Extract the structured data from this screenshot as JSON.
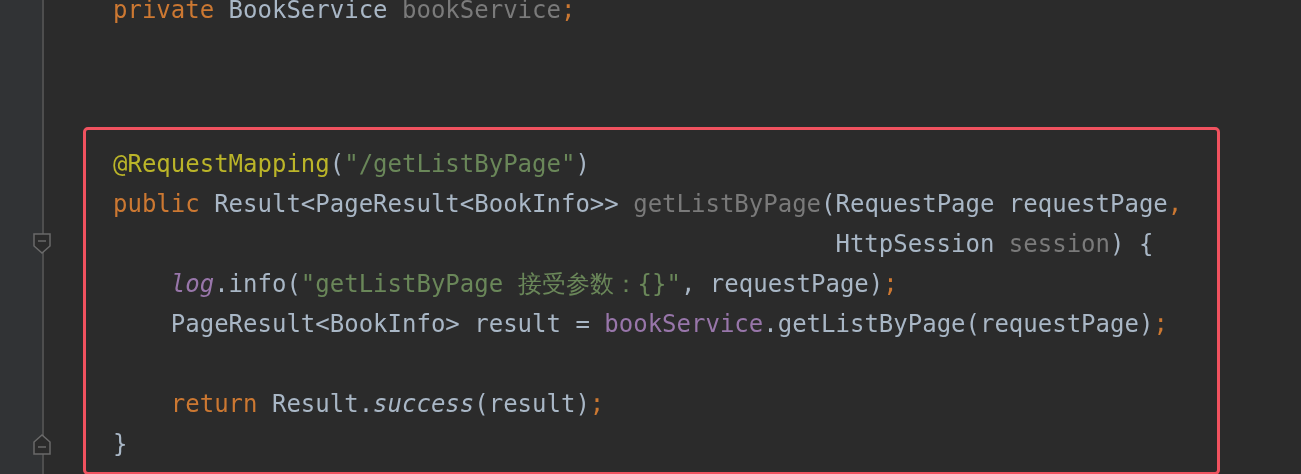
{
  "editor": {
    "lines": [
      {
        "kind": "code",
        "tokens": [
          {
            "text": "private ",
            "kind": "keyword"
          },
          {
            "text": "BookService ",
            "kind": "plain"
          },
          {
            "text": "bookService",
            "kind": "unused"
          },
          {
            "text": ";",
            "kind": "keyword"
          }
        ]
      },
      {
        "kind": "blank"
      },
      {
        "kind": "blank"
      }
    ],
    "highlighted_block": {
      "lines": [
        {
          "kind": "code",
          "tokens": [
            {
              "text": "@RequestMapping",
              "kind": "annotation"
            },
            {
              "text": "(",
              "kind": "plain"
            },
            {
              "text": "\"/getListByPage\"",
              "kind": "string"
            },
            {
              "text": ")",
              "kind": "plain"
            }
          ]
        },
        {
          "kind": "code",
          "tokens": [
            {
              "text": "public",
              "kind": "keyword"
            },
            {
              "text": " Result<PageResult<BookInfo>> ",
              "kind": "plain"
            },
            {
              "text": "getListByPage",
              "kind": "unused"
            },
            {
              "text": "(RequestPage requestPage",
              "kind": "plain"
            },
            {
              "text": ",",
              "kind": "keyword"
            }
          ]
        },
        {
          "kind": "fold-start",
          "tokens": [
            {
              "text": "                                                  HttpSession ",
              "kind": "plain"
            },
            {
              "text": "session",
              "kind": "unused"
            },
            {
              "text": ") {",
              "kind": "plain"
            }
          ]
        },
        {
          "kind": "code",
          "tokens": [
            {
              "text": "    log",
              "kind": "static"
            },
            {
              "text": ".info(",
              "kind": "plain"
            },
            {
              "text": "\"getListByPage 接受参数：{}\"",
              "kind": "string"
            },
            {
              "text": ", requestPage)",
              "kind": "plain"
            },
            {
              "text": ";",
              "kind": "keyword"
            }
          ]
        },
        {
          "kind": "code",
          "tokens": [
            {
              "text": "    PageResult<BookInfo> result = ",
              "kind": "plain"
            },
            {
              "text": "bookService",
              "kind": "field"
            },
            {
              "text": ".getListByPage(requestPage)",
              "kind": "plain"
            },
            {
              "text": ";",
              "kind": "keyword"
            }
          ]
        },
        {
          "kind": "blank"
        },
        {
          "kind": "code",
          "tokens": [
            {
              "text": "    return",
              "kind": "keyword"
            },
            {
              "text": " Result.",
              "kind": "plain"
            },
            {
              "text": "success",
              "kind": "italic"
            },
            {
              "text": "(result)",
              "kind": "plain"
            },
            {
              "text": ";",
              "kind": "keyword"
            }
          ]
        },
        {
          "kind": "fold-end",
          "tokens": [
            {
              "text": "}",
              "kind": "plain"
            }
          ]
        }
      ]
    }
  }
}
